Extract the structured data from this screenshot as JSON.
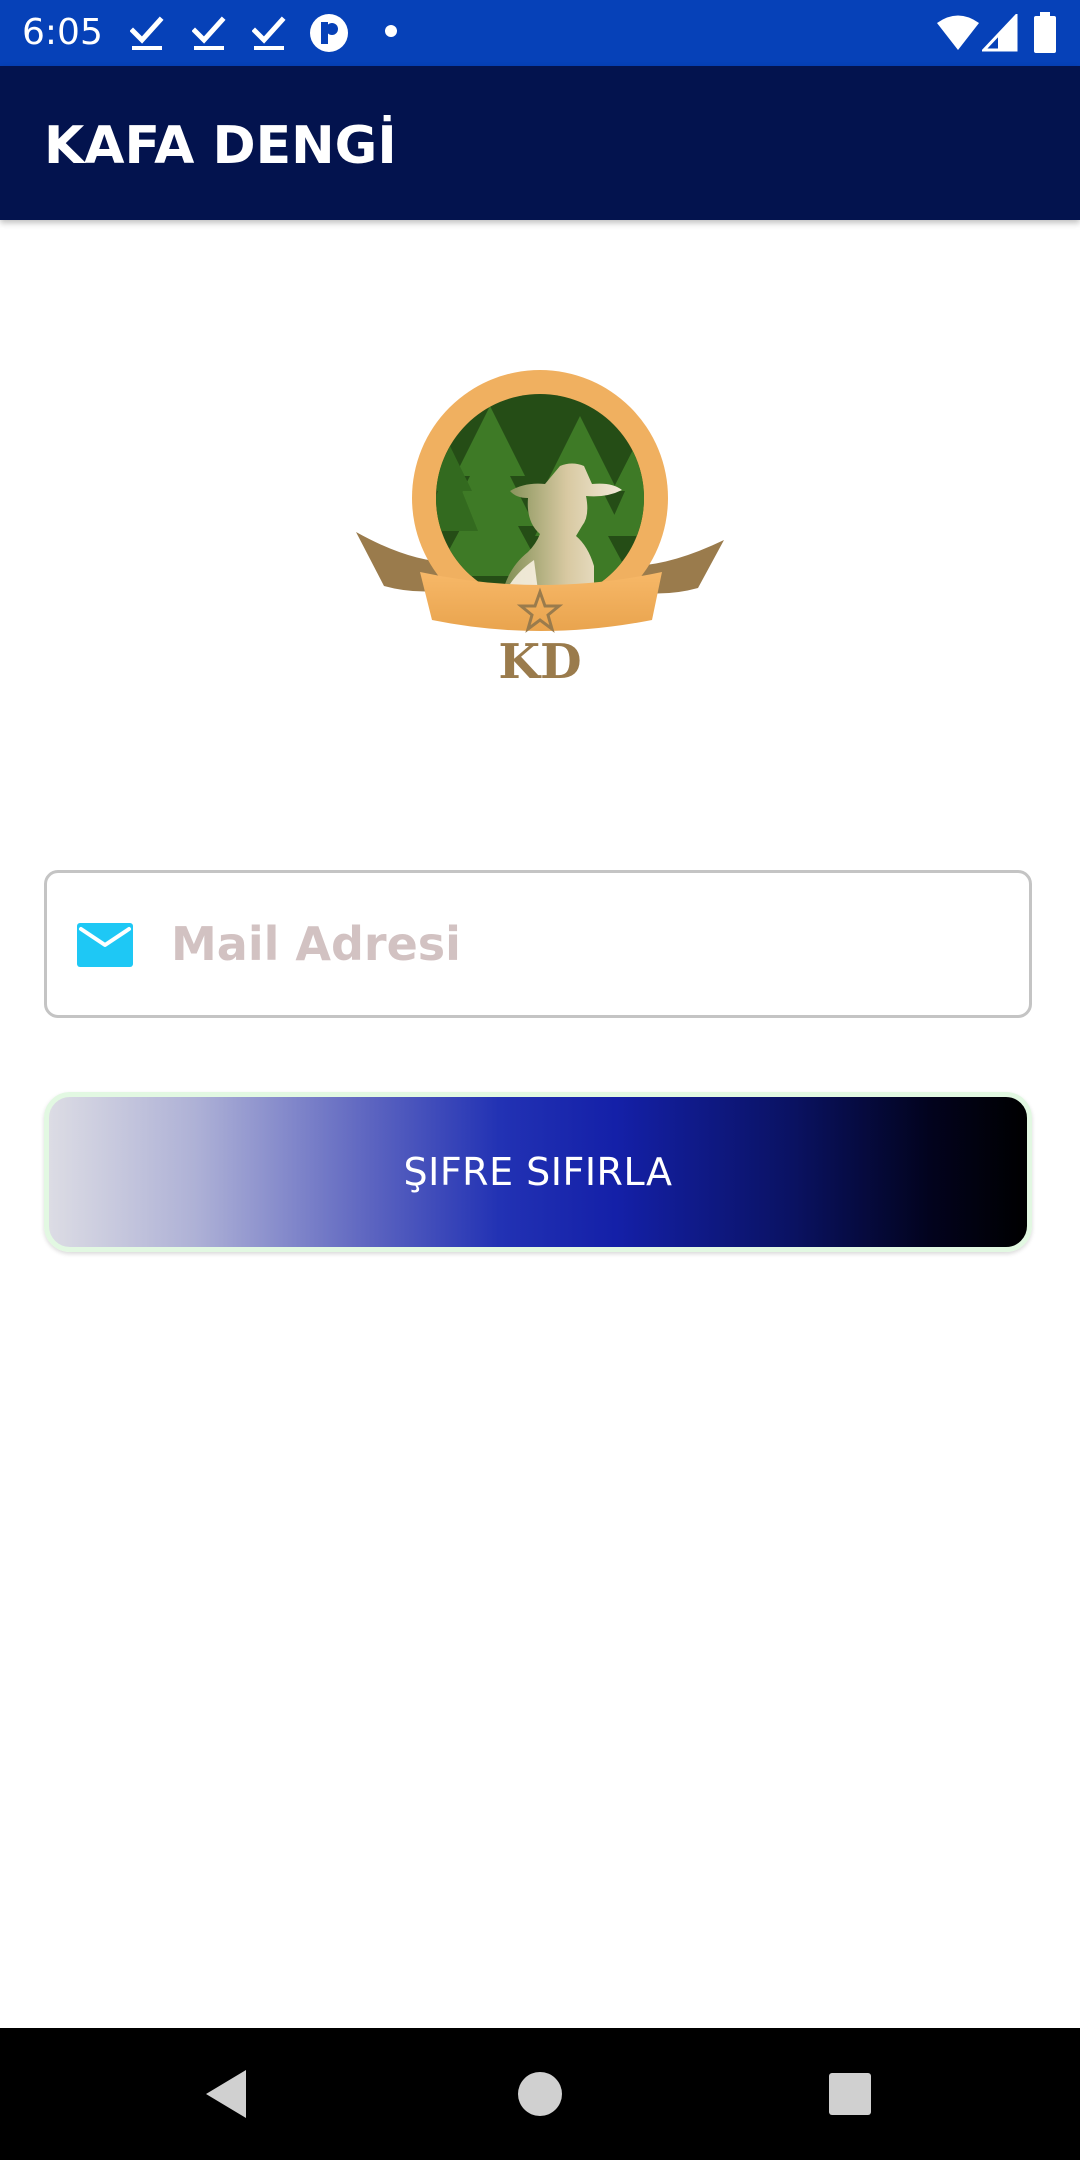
{
  "status_bar": {
    "time": "6:05",
    "left_icons": [
      "check-download-icon",
      "check-download-icon",
      "check-download-icon",
      "p-circle-icon",
      "dot-icon"
    ],
    "right_icons": [
      "wifi-icon",
      "signal-icon",
      "battery-icon"
    ],
    "background": "#0641b8"
  },
  "app_bar": {
    "title": "KAFA DENGİ",
    "background": "#03134e"
  },
  "logo": {
    "monogram": "KD"
  },
  "form": {
    "email": {
      "placeholder": "Mail Adresi",
      "value": "",
      "icon": "mail-icon",
      "icon_color": "#1ec8f5"
    },
    "reset_button": {
      "label": "ŞIFRE SIFIRLA"
    }
  },
  "nav_bar": {
    "buttons": [
      "back-icon",
      "home-icon",
      "recents-icon"
    ]
  }
}
